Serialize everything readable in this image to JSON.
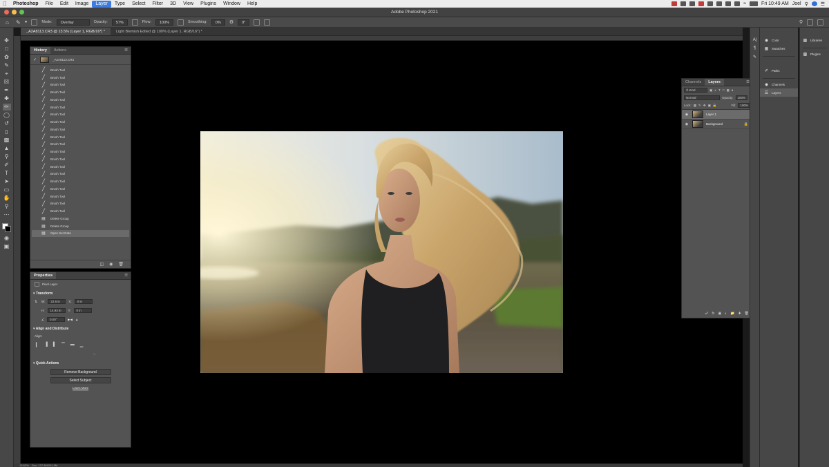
{
  "menubar": {
    "items": [
      "Photoshop",
      "File",
      "Edit",
      "Image",
      "Layer",
      "Type",
      "Select",
      "Filter",
      "3D",
      "View",
      "Plugins",
      "Window",
      "Help"
    ],
    "active_item": "Layer",
    "clock": "Fri 10:49 AM",
    "user": "Joel"
  },
  "window": {
    "title": "Adobe Photoshop 2021"
  },
  "options_bar": {
    "mode_label": "Mode:",
    "mode_value": "Overlay",
    "opacity_label": "Opacity:",
    "opacity_value": "57%",
    "flow_label": "Flow:",
    "flow_value": "100%",
    "smoothing_label": "Smoothing:",
    "smoothing_value": "0%",
    "angle_value": "0°"
  },
  "document_tabs": [
    {
      "label": "_A2A8113.CR3 @ 13.5% (Layer 1, RGB/16*) *",
      "active": true
    },
    {
      "label": "Light Blemish Edited @ 100% (Layer 1, RGB/16*) *",
      "active": false
    }
  ],
  "history_panel": {
    "tabs": [
      "History",
      "Actions"
    ],
    "snapshot_label": "_A2A8113.CR3",
    "steps": [
      "Brush Tool",
      "Brush Tool",
      "Brush Tool",
      "Brush Tool",
      "Brush Tool",
      "Brush Tool",
      "Brush Tool",
      "Brush Tool",
      "Brush Tool",
      "Brush Tool",
      "Brush Tool",
      "Brush Tool",
      "Brush Tool",
      "Brush Tool",
      "Brush Tool",
      "Brush Tool",
      "Brush Tool",
      "Brush Tool",
      "Brush Tool",
      "Brush Tool",
      "Delete Group",
      "Delete Group",
      "Open Set Data"
    ]
  },
  "properties_panel": {
    "title": "Properties",
    "layer_type": "Pixel Layer",
    "transform_title": "Transform",
    "w_value": "22.6 in",
    "x_value": "0 in",
    "h_value": "14.93 in",
    "y_value": "0 in",
    "angle_value": "0.00°",
    "align_title": "Align and Distribute",
    "align_label": "Align:",
    "quick_actions_title": "Quick Actions",
    "remove_bg_button": "Remove Background",
    "select_subject_button": "Select Subject",
    "learn_more_link": "Learn More"
  },
  "layers_panel": {
    "tabs": [
      "Channels",
      "Layers"
    ],
    "filter_label": "Kind",
    "blend_mode": "Normal",
    "opacity_label": "Opacity:",
    "opacity_value": "100%",
    "lock_label": "Lock:",
    "fill_label": "Fill:",
    "fill_value": "100%",
    "layers": [
      {
        "name": "Layer 1",
        "active": true
      },
      {
        "name": "Background",
        "active": false
      }
    ]
  },
  "right_docks": {
    "dock_top": [
      "Color",
      "Swatches"
    ],
    "dock_mid": [
      "Paths",
      "Channels",
      "Layers"
    ],
    "dock_far": [
      "Libraries",
      "Plugins"
    ]
  },
  "status_bar": {
    "zoom": "13.53%",
    "doc_info": "Doc: 137.3M/241.9M"
  },
  "colors": {
    "menu_accent": "#3d7be0",
    "panel_bg": "#535353",
    "workspace_bg": "#000000"
  }
}
